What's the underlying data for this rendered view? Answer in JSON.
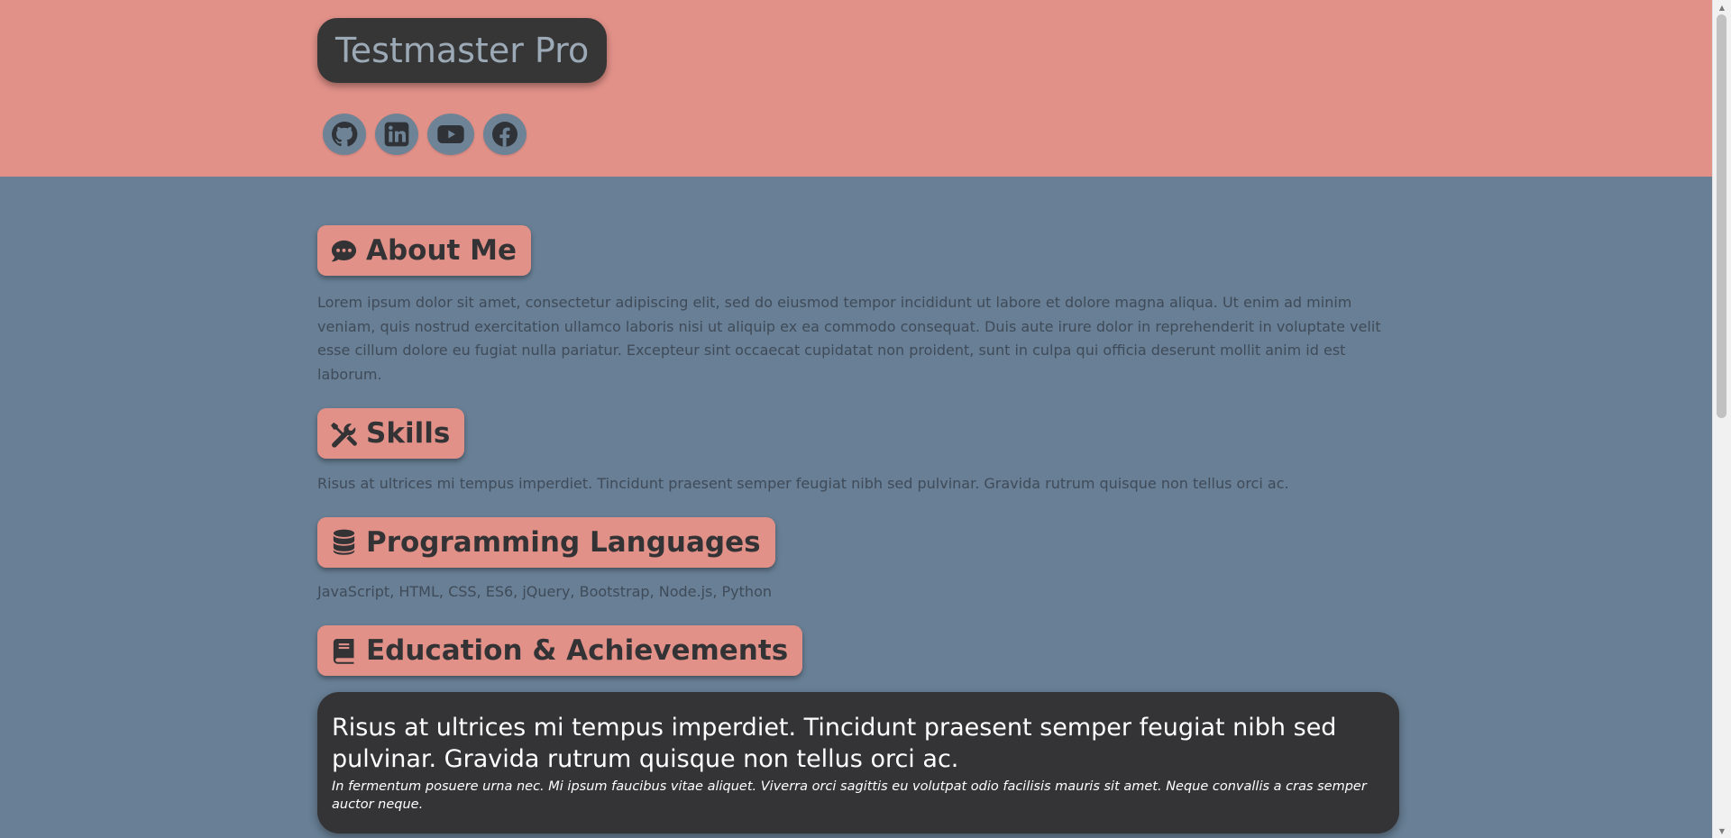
{
  "header": {
    "brand": "Testmaster Pro",
    "socials": [
      {
        "icon": "github-icon"
      },
      {
        "icon": "linkedin-icon"
      },
      {
        "icon": "youtube-icon"
      },
      {
        "icon": "facebook-icon"
      }
    ]
  },
  "sections": {
    "about": {
      "icon": "comment-dots-icon",
      "title": "About Me",
      "text": "Lorem ipsum dolor sit amet, consectetur adipiscing elit, sed do eiusmod tempor incididunt ut labore et dolore magna aliqua. Ut enim ad minim veniam, quis nostrud exercitation ullamco laboris nisi ut aliquip ex ea commodo consequat. Duis aute irure dolor in reprehenderit in voluptate velit esse cillum dolore eu fugiat nulla pariatur. Excepteur sint occaecat cupidatat non proident, sunt in culpa qui officia deserunt mollit anim id est laborum."
    },
    "skills": {
      "icon": "tools-icon",
      "title": "Skills",
      "text": "Risus at ultrices mi tempus imperdiet. Tincidunt praesent semper feugiat nibh sed pulvinar. Gravida rutrum quisque non tellus orci ac."
    },
    "languages": {
      "icon": "database-icon",
      "title": "Programming Languages",
      "text": "JavaScript, HTML, CSS, ES6, jQuery, Bootstrap, Node.js, Python"
    },
    "education": {
      "icon": "book-icon",
      "title": "Education & Achievements",
      "card": {
        "title": "Risus at ultrices mi tempus imperdiet. Tincidunt praesent semper feugiat nibh sed pulvinar. Gravida rutrum quisque non tellus orci ac.",
        "subtitle": "In fermentum posuere urna nec. Mi ipsum faucibus vitae aliquet. Viverra orci sagittis eu volutpat odio facilisis mauris sit amet. Neque convallis a cras semper auctor neque."
      }
    }
  },
  "colors": {
    "header_bg": "#e19188",
    "page_bg": "#687f95",
    "brand_bg": "#363636",
    "brand_text": "#9ca9b6",
    "section_pill_bg": "#e19188",
    "card_bg": "#343436"
  }
}
